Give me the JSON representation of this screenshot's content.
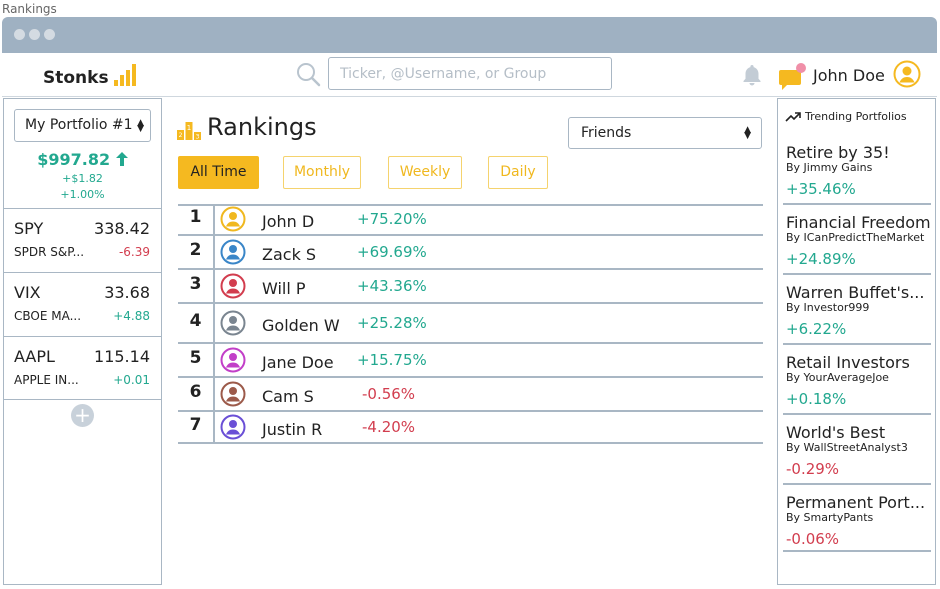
{
  "window": {
    "title": "Rankings"
  },
  "app": {
    "name": "Stonks"
  },
  "search": {
    "placeholder": "Ticker, @Username, or Group"
  },
  "user": {
    "name": "John Doe"
  },
  "colors": {
    "accent": "#f5b920",
    "positive": "#22a88f",
    "negative": "#d23d4e",
    "border": "#a9b7c4",
    "titlebar": "#9fb1c2"
  },
  "portfolio": {
    "selected": "My Portfolio #1",
    "value": "$997.82",
    "change_abs": "+$1.82",
    "change_pct": "+1.00%"
  },
  "tickers": [
    {
      "symbol": "SPY",
      "price": "338.42",
      "name": "SPDR S&P...",
      "change": "-6.39",
      "direction": "down"
    },
    {
      "symbol": "VIX",
      "price": "33.68",
      "name": "CBOE MA...",
      "change": "+4.88",
      "direction": "up"
    },
    {
      "symbol": "AAPL",
      "price": "115.14",
      "name": "APPLE IN...",
      "change": "+0.01",
      "direction": "up"
    }
  ],
  "add_ticker_label": "+",
  "main": {
    "title": "Rankings",
    "filter": "Friends",
    "tabs": [
      {
        "label": "All Time",
        "active": true
      },
      {
        "label": "Monthly",
        "active": false
      },
      {
        "label": "Weekly",
        "active": false
      },
      {
        "label": "Daily",
        "active": false
      }
    ],
    "rankings": [
      {
        "rank": "1",
        "name": "John D",
        "change": "+75.20%",
        "avatar_color": "#f0b81f",
        "direction": "up"
      },
      {
        "rank": "2",
        "name": "Zack S",
        "change": "+69.69%",
        "avatar_color": "#3a86c8",
        "direction": "up"
      },
      {
        "rank": "3",
        "name": "Will P",
        "change": "+43.36%",
        "avatar_color": "#d23d4e",
        "direction": "up"
      },
      {
        "rank": "4",
        "name": "Golden W",
        "change": "+25.28%",
        "avatar_color": "#7a8590",
        "direction": "up"
      },
      {
        "rank": "5",
        "name": "Jane Doe",
        "change": "+15.75%",
        "avatar_color": "#c23fc8",
        "direction": "up"
      },
      {
        "rank": "6",
        "name": "Cam S",
        "change": "-0.56%",
        "avatar_color": "#9c5a4a",
        "direction": "down"
      },
      {
        "rank": "7",
        "name": "Justin R",
        "change": "-4.20%",
        "avatar_color": "#6a4fd6",
        "direction": "down"
      }
    ]
  },
  "trending": {
    "title": "Trending Portfolios",
    "items": [
      {
        "name": "Retire by 35!",
        "by": "By Jimmy Gains",
        "return": "+35.46%",
        "direction": "up"
      },
      {
        "name": "Financial Freedom",
        "by": "By ICanPredictTheMarket",
        "return": "+24.89%",
        "direction": "up"
      },
      {
        "name": "Warren Buffet's...",
        "by": "By Investor999",
        "return": "+6.22%",
        "direction": "up"
      },
      {
        "name": "Retail Investors",
        "by": "By YourAverageJoe",
        "return": "+0.18%",
        "direction": "up"
      },
      {
        "name": "World's Best",
        "by": "By WallStreetAnalyst3",
        "return": "-0.29%",
        "direction": "down"
      },
      {
        "name": "Permanent Port...",
        "by": "By SmartyPants",
        "return": "-0.06%",
        "direction": "down"
      }
    ]
  }
}
